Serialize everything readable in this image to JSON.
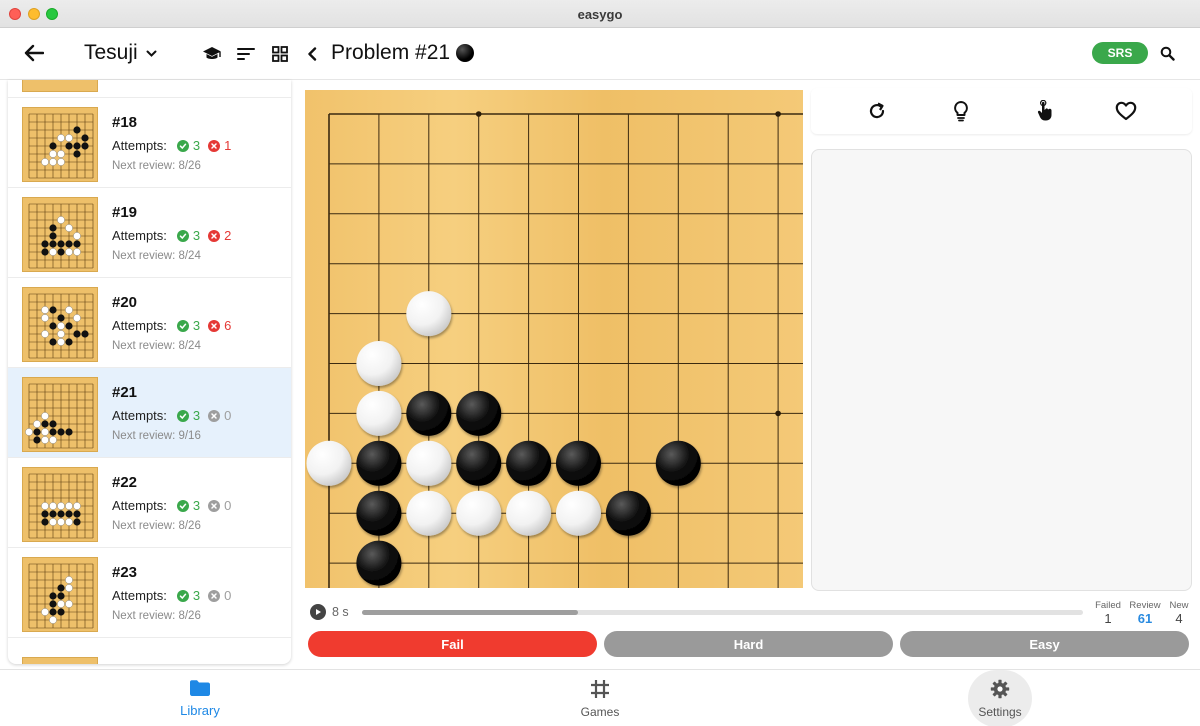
{
  "window": {
    "title": "easygo"
  },
  "toolbar": {
    "collection_title": "Tesuji",
    "problem_title": "Problem #21",
    "srs_label": "SRS"
  },
  "list": {
    "attempts_label": "Attempts:",
    "items": [
      {
        "num": "#18",
        "ok": "3",
        "fail": "1",
        "fail_style": "red",
        "next": "Next review: 8/26"
      },
      {
        "num": "#19",
        "ok": "3",
        "fail": "2",
        "fail_style": "red",
        "next": "Next review: 8/24"
      },
      {
        "num": "#20",
        "ok": "3",
        "fail": "6",
        "fail_style": "red",
        "next": "Next review: 8/24"
      },
      {
        "num": "#21",
        "ok": "3",
        "fail": "0",
        "fail_style": "gray",
        "next": "Next review: 9/16",
        "selected": true
      },
      {
        "num": "#22",
        "ok": "3",
        "fail": "0",
        "fail_style": "gray",
        "next": "Next review: 8/26"
      },
      {
        "num": "#23",
        "ok": "3",
        "fail": "0",
        "fail_style": "gray",
        "next": "Next review: 8/26"
      }
    ]
  },
  "board": {
    "size": 19,
    "visible_cols": 10,
    "visible_rows": 10,
    "hoshi": [
      [
        3,
        0
      ],
      [
        9,
        0
      ],
      [
        9,
        6
      ]
    ],
    "black": [
      [
        2,
        6
      ],
      [
        3,
        6
      ],
      [
        1,
        7
      ],
      [
        3,
        7
      ],
      [
        4,
        7
      ],
      [
        5,
        7
      ],
      [
        7,
        7
      ],
      [
        1,
        8
      ],
      [
        6,
        8
      ],
      [
        1,
        9
      ]
    ],
    "white": [
      [
        2,
        4
      ],
      [
        1,
        5
      ],
      [
        1,
        6
      ],
      [
        0,
        7
      ],
      [
        2,
        7
      ],
      [
        2,
        8
      ],
      [
        3,
        8
      ],
      [
        4,
        8
      ],
      [
        5,
        8
      ]
    ]
  },
  "actions": {
    "icons": [
      "reset-icon",
      "hint-icon",
      "tap-icon",
      "favorite-icon"
    ]
  },
  "timer": {
    "value": "8 s",
    "progress": 0.3
  },
  "stats": {
    "failed_label": "Failed",
    "failed_value": "1",
    "review_label": "Review",
    "review_value": "61",
    "new_label": "New",
    "new_value": "4"
  },
  "grade": {
    "fail": "Fail",
    "hard": "Hard",
    "easy": "Easy"
  },
  "nav": {
    "library": "Library",
    "games": "Games",
    "settings": "Settings"
  },
  "colors": {
    "accent": "#1e88e5",
    "success": "#3aa84b",
    "fail": "#f03b2f",
    "board": "#f2c672"
  }
}
